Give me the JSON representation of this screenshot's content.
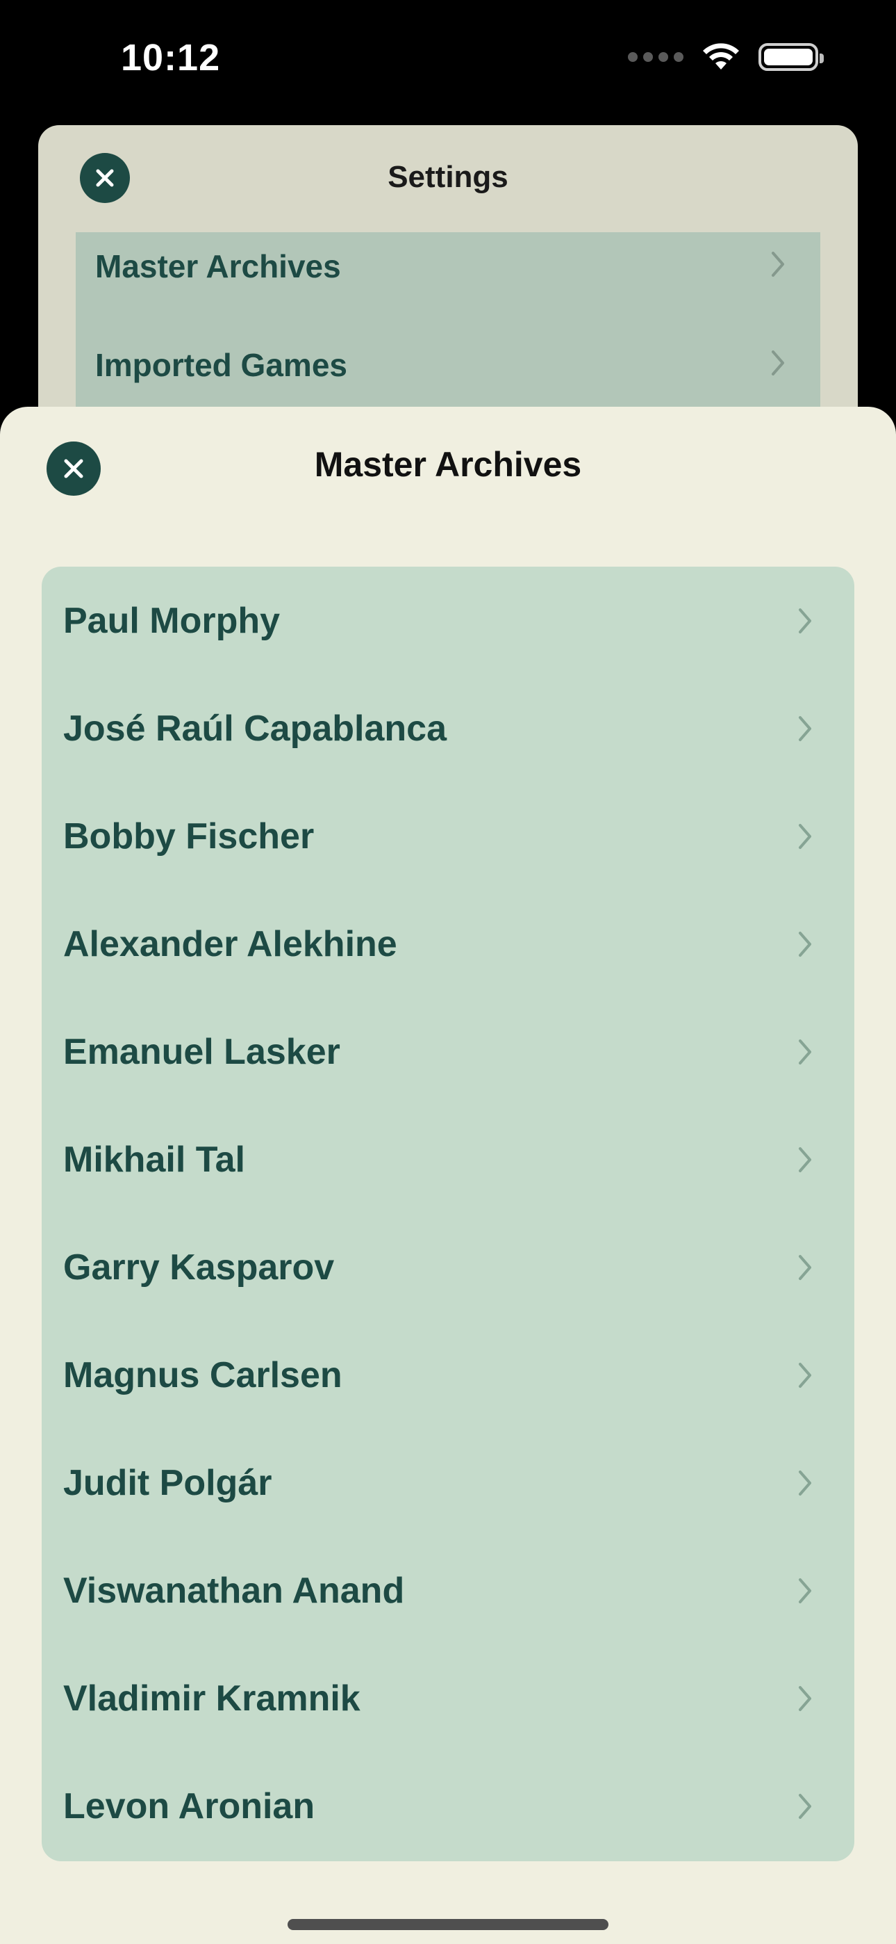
{
  "status_bar": {
    "time": "10:12",
    "icons": [
      "cellular-signal-icon",
      "wifi-icon",
      "battery-icon"
    ]
  },
  "settings_sheet": {
    "title": "Settings",
    "close_icon": "close-icon",
    "items": [
      {
        "label": "Master Archives"
      },
      {
        "label": "Imported Games"
      }
    ]
  },
  "archives_sheet": {
    "title": "Master Archives",
    "close_icon": "close-icon",
    "items": [
      {
        "label": "Paul Morphy"
      },
      {
        "label": "José Raúl Capablanca"
      },
      {
        "label": "Bobby Fischer"
      },
      {
        "label": "Alexander Alekhine"
      },
      {
        "label": "Emanuel Lasker"
      },
      {
        "label": "Mikhail Tal"
      },
      {
        "label": "Garry Kasparov"
      },
      {
        "label": "Magnus Carlsen"
      },
      {
        "label": "Judit Polgár"
      },
      {
        "label": "Viswanathan Anand"
      },
      {
        "label": "Vladimir Kramnik"
      },
      {
        "label": "Levon Aronian"
      }
    ]
  },
  "colors": {
    "accent": "#1d4a44",
    "sheet_background": "#f0efe0",
    "list_background": "#c5dbcb",
    "settings_background": "#d8d8c8",
    "settings_list_background": "#b2c6b8"
  }
}
